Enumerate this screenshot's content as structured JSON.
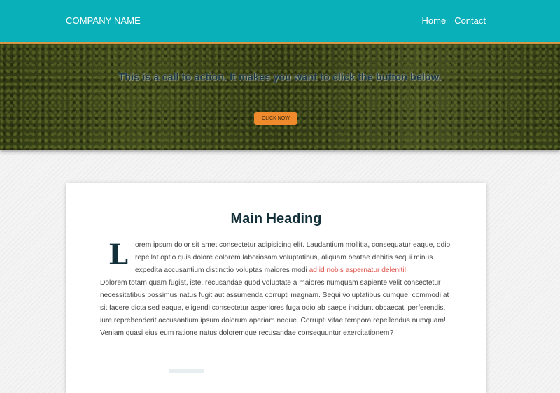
{
  "header": {
    "brand": "COMPANY NAME",
    "nav": [
      "Home",
      "Contact"
    ]
  },
  "hero": {
    "cta_text": "This is a call to action. It makes you want to click the button below.",
    "button_label": "CLICK NOW"
  },
  "content": {
    "heading": "Main Heading",
    "dropcap": "L",
    "paragraph_start": "orem ipsum dolor sit amet consectetur adipisicing elit. Laudantium mollitia, consequatur eaque, odio repellat optio quis dolore dolorem laboriosam voluptatibus, aliquam beatae debitis sequi minus expedita accusantium distinctio voluptas maiores modi",
    "highlight": "ad id nobis aspernatur deleniti!",
    "paragraph_rest": "Dolorem totam quam fugiat, iste, recusandae quod voluptate a maiores numquam sapiente velit consectetur necessitatibus possimus natus fugit aut assumenda corrupti magnam. Sequi voluptatibus cumque, commodi at sit facere dicta sed eaque, eligendi consectetur asperiores fuga odio ab saepe incidunt obcaecati perferendis, iure reprehenderit accusantium ipsum dolorum aperiam neque. Corrupti vitae tempora repellendus numquam! Veniam quasi eius eum ratione natus doloremque recusandae consequuntur exercitationem?"
  },
  "colors": {
    "header_bg": "#0ab0b9",
    "header_border": "#d89a46",
    "button_bg": "#ef8b2c",
    "heading_text": "#13303a",
    "highlight_text": "#e0524a"
  }
}
